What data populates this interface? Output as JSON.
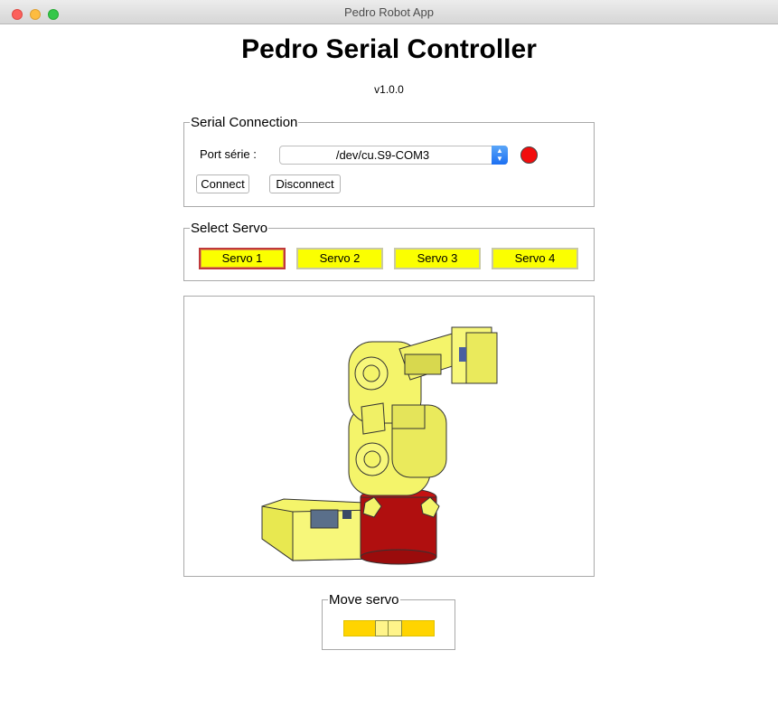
{
  "window": {
    "title": "Pedro Robot App"
  },
  "header": {
    "title": "Pedro Serial Controller",
    "version": "v1.0.0"
  },
  "serial": {
    "legend": "Serial Connection",
    "port_label": "Port série :",
    "port_value": "/dev/cu.S9-COM3",
    "status_color": "#f20d0d",
    "connect_label": "Connect",
    "disconnect_label": "Disconnect"
  },
  "servo_select": {
    "legend": "Select Servo",
    "selected": "Servo 1",
    "buttons": [
      {
        "label": "Servo 1"
      },
      {
        "label": "Servo 2"
      },
      {
        "label": "Servo 3"
      },
      {
        "label": "Servo 4"
      }
    ],
    "button_color": "#fbff00"
  },
  "move": {
    "legend": "Move servo",
    "slider_value": 0.5
  }
}
